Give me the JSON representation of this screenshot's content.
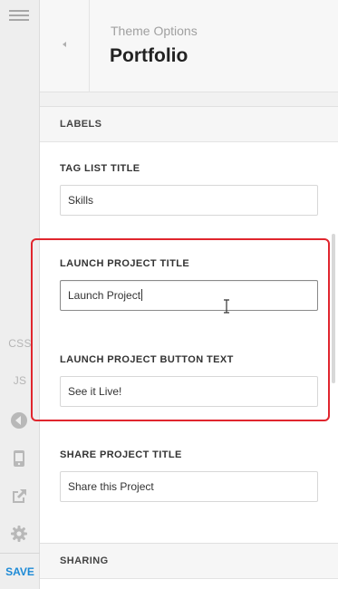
{
  "rail": {
    "css_label": "CSS",
    "js_label": "JS",
    "save_label": "SAVE",
    "icons": [
      "hamburger-menu-icon",
      "collapse-icon",
      "mobile-preview-icon",
      "external-link-icon",
      "gear-icon"
    ]
  },
  "header": {
    "subtitle": "Theme Options",
    "title": "Portfolio"
  },
  "sections": {
    "labels_title": "LABELS",
    "sharing_title": "SHARING"
  },
  "fields": {
    "tag_list": {
      "label": "TAG LIST TITLE",
      "value": "Skills"
    },
    "launch_title": {
      "label": "LAUNCH PROJECT TITLE",
      "value": "Launch Project"
    },
    "launch_button": {
      "label": "LAUNCH PROJECT BUTTON TEXT",
      "value": "See it Live!"
    },
    "share_title": {
      "label": "SHARE PROJECT TITLE",
      "value": "Share this Project"
    }
  },
  "colors": {
    "accent": "#1d8ad6",
    "highlight": "#e0262e"
  }
}
